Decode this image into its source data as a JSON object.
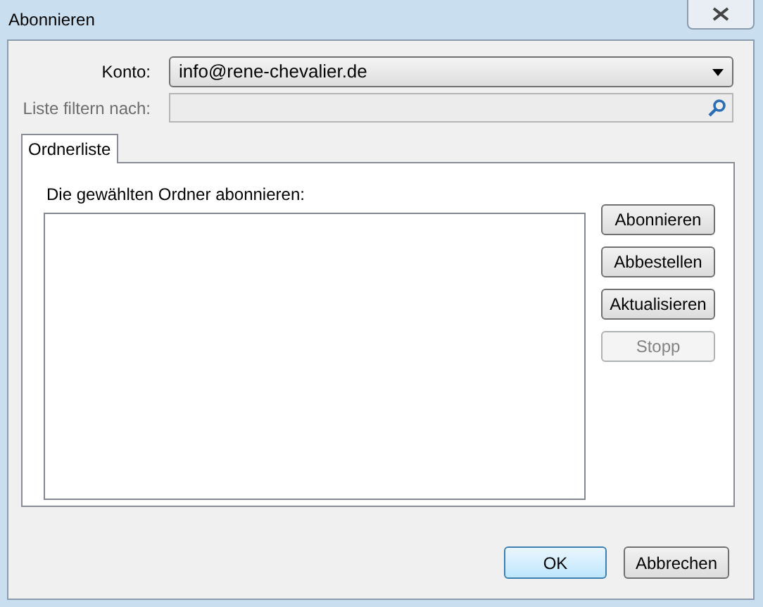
{
  "window": {
    "title": "Abonnieren"
  },
  "account": {
    "label": "Konto:",
    "value": "info@rene-chevalier.de"
  },
  "filter": {
    "label": "Liste filtern nach:",
    "disabled": true
  },
  "tabs": [
    {
      "label": "Ordnerliste",
      "selected": true
    }
  ],
  "folder_list": {
    "label": "Die gewählten Ordner abonnieren:"
  },
  "side_buttons": [
    {
      "label": "Abonnieren",
      "disabled": false
    },
    {
      "label": "Abbestellen",
      "disabled": false
    },
    {
      "label": "Aktualisieren",
      "disabled": false
    },
    {
      "label": "Stopp",
      "disabled": true
    }
  ],
  "buttons": [
    {
      "label": "OK",
      "default": true
    },
    {
      "label": "Abbrechen",
      "default": false
    }
  ]
}
